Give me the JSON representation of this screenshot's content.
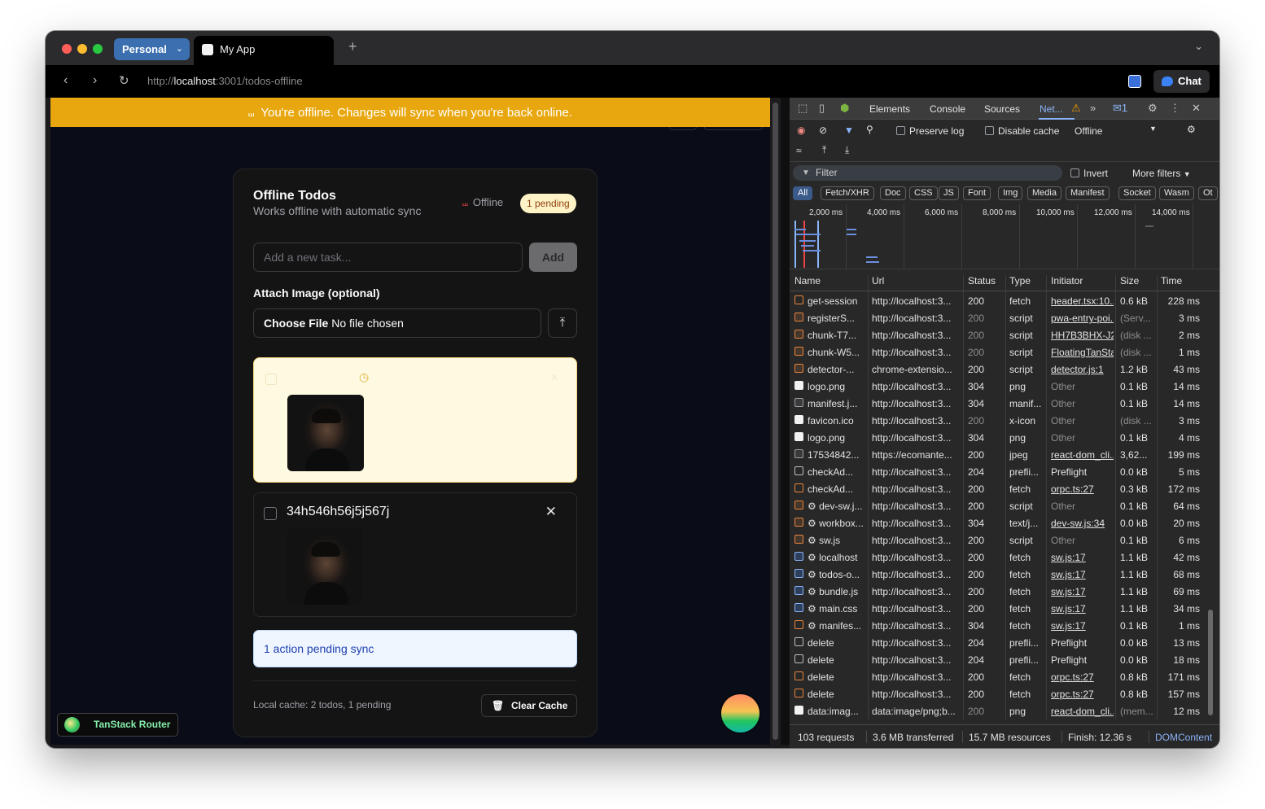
{
  "browser": {
    "profile": "Personal",
    "tab_title": "My App",
    "url_scheme": "http://",
    "url_host": "localhost",
    "url_rest": ":3001/todos-offline",
    "chat_button": "Chat"
  },
  "page": {
    "offline_banner": "You're offline. Changes will sync when you're back online.",
    "card": {
      "title": "Offline Todos",
      "subtitle": "Works offline with automatic sync",
      "status": "Offline",
      "pending_badge": "1 pending",
      "task_placeholder": "Add a new task...",
      "add_button": "Add",
      "attach_label": "Attach Image (optional)",
      "file_button": "Choose File",
      "file_status": "No file chosen",
      "todos": [
        {
          "title": "",
          "pending": true
        },
        {
          "title": "34h546h56j5j567j",
          "pending": false
        }
      ],
      "sync_notice": "1 action pending sync",
      "cache_info": "Local cache: 2 todos, 1 pending",
      "clear_cache": "Clear Cache"
    },
    "router_badge": "TanStack Router"
  },
  "devtools": {
    "tabs": [
      "Elements",
      "Console",
      "Sources",
      "Net..."
    ],
    "issues_count": "1",
    "toolbar": {
      "preserve_log": "Preserve log",
      "disable_cache": "Disable cache",
      "throttle": "Offline"
    },
    "filter_placeholder": "Filter",
    "invert": "Invert",
    "more_filters": "More filters",
    "type_filters": [
      "All",
      "Fetch/XHR",
      "Doc",
      "CSS",
      "JS",
      "Font",
      "Img",
      "Media",
      "Manifest",
      "Socket",
      "Wasm",
      "Ot"
    ],
    "timeline_labels": [
      "2,000 ms",
      "4,000 ms",
      "6,000 ms",
      "8,000 ms",
      "10,000 ms",
      "12,000 ms",
      "14,000 ms"
    ],
    "columns": [
      "Name",
      "Url",
      "Status",
      "Type",
      "Initiator",
      "Size",
      "Time"
    ],
    "requests": [
      {
        "name": "get-session",
        "url": "http://localhost:3...",
        "status": "200",
        "type": "fetch",
        "initiator": "header.tsx:10...",
        "size": "0.6 kB",
        "time": "228 ms",
        "icon": "fetch",
        "status_dim": false,
        "init_link": true,
        "size_dim": false
      },
      {
        "name": "registerS...",
        "url": "http://localhost:3...",
        "status": "200",
        "type": "script",
        "initiator": "pwa-entry-poi...",
        "size": "(Serv...",
        "time": "3 ms",
        "icon": "script",
        "status_dim": true,
        "init_link": true,
        "size_dim": true
      },
      {
        "name": "chunk-T7...",
        "url": "http://localhost:3...",
        "status": "200",
        "type": "script",
        "initiator": "HH7B3BHX-J2...",
        "size": "(disk ...",
        "time": "2 ms",
        "icon": "script",
        "status_dim": true,
        "init_link": true,
        "size_dim": true
      },
      {
        "name": "chunk-W5...",
        "url": "http://localhost:3...",
        "status": "200",
        "type": "script",
        "initiator": "FloatingTanSta...",
        "size": "(disk ...",
        "time": "1 ms",
        "icon": "script",
        "status_dim": true,
        "init_link": true,
        "size_dim": true
      },
      {
        "name": "detector-...",
        "url": "chrome-extensio...",
        "status": "200",
        "type": "script",
        "initiator": "detector.js:1",
        "size": "1.2 kB",
        "time": "43 ms",
        "icon": "script",
        "status_dim": false,
        "init_link": true,
        "size_dim": false
      },
      {
        "name": "logo.png",
        "url": "http://localhost:3...",
        "status": "304",
        "type": "png",
        "initiator": "Other",
        "size": "0.1 kB",
        "time": "14 ms",
        "icon": "img",
        "status_dim": false,
        "init_link": false,
        "size_dim": false
      },
      {
        "name": "manifest.j...",
        "url": "http://localhost:3...",
        "status": "304",
        "type": "manif...",
        "initiator": "Other",
        "size": "0.1 kB",
        "time": "14 ms",
        "icon": "doc",
        "status_dim": false,
        "init_link": false,
        "size_dim": false
      },
      {
        "name": "favicon.ico",
        "url": "http://localhost:3...",
        "status": "200",
        "type": "x-icon",
        "initiator": "Other",
        "size": "(disk ...",
        "time": "3 ms",
        "icon": "img",
        "status_dim": true,
        "init_link": false,
        "size_dim": true
      },
      {
        "name": "logo.png",
        "url": "http://localhost:3...",
        "status": "304",
        "type": "png",
        "initiator": "Other",
        "size": "0.1 kB",
        "time": "4 ms",
        "icon": "img",
        "status_dim": false,
        "init_link": false,
        "size_dim": false
      },
      {
        "name": "17534842...",
        "url": "https://ecomante...",
        "status": "200",
        "type": "jpeg",
        "initiator": "react-dom_cli...",
        "size": "3,62...",
        "time": "199 ms",
        "icon": "doc",
        "status_dim": false,
        "init_link": true,
        "size_dim": false
      },
      {
        "name": "checkAd...",
        "url": "http://localhost:3...",
        "status": "204",
        "type": "prefli...",
        "initiator": "Preflight",
        "size": "0.0 kB",
        "time": "5 ms",
        "icon": "pre",
        "status_dim": false,
        "init_link": false,
        "size_dim": false
      },
      {
        "name": "checkAd...",
        "url": "http://localhost:3...",
        "status": "200",
        "type": "fetch",
        "initiator": "orpc.ts:27",
        "size": "0.3 kB",
        "time": "172 ms",
        "icon": "fetch",
        "status_dim": false,
        "init_link": true,
        "size_dim": false
      },
      {
        "name": "⚙ dev-sw.j...",
        "url": "http://localhost:3...",
        "status": "200",
        "type": "script",
        "initiator": "Other",
        "size": "0.1 kB",
        "time": "64 ms",
        "icon": "script",
        "status_dim": false,
        "init_link": false,
        "size_dim": false
      },
      {
        "name": "⚙ workbox...",
        "url": "http://localhost:3...",
        "status": "304",
        "type": "text/j...",
        "initiator": "dev-sw.js:34",
        "size": "0.0 kB",
        "time": "20 ms",
        "icon": "script",
        "status_dim": false,
        "init_link": true,
        "size_dim": false
      },
      {
        "name": "⚙ sw.js",
        "url": "http://localhost:3...",
        "status": "200",
        "type": "script",
        "initiator": "Other",
        "size": "0.1 kB",
        "time": "6 ms",
        "icon": "script",
        "status_dim": false,
        "init_link": false,
        "size_dim": false
      },
      {
        "name": "⚙ localhost",
        "url": "http://localhost:3...",
        "status": "200",
        "type": "fetch",
        "initiator": "sw.js:17",
        "size": "1.1 kB",
        "time": "42 ms",
        "icon": "sw",
        "status_dim": false,
        "init_link": true,
        "size_dim": false
      },
      {
        "name": "⚙ todos-o...",
        "url": "http://localhost:3...",
        "status": "200",
        "type": "fetch",
        "initiator": "sw.js:17",
        "size": "1.1 kB",
        "time": "68 ms",
        "icon": "sw",
        "status_dim": false,
        "init_link": true,
        "size_dim": false
      },
      {
        "name": "⚙ bundle.js",
        "url": "http://localhost:3...",
        "status": "200",
        "type": "fetch",
        "initiator": "sw.js:17",
        "size": "1.1 kB",
        "time": "69 ms",
        "icon": "sw",
        "status_dim": false,
        "init_link": true,
        "size_dim": false
      },
      {
        "name": "⚙ main.css",
        "url": "http://localhost:3...",
        "status": "200",
        "type": "fetch",
        "initiator": "sw.js:17",
        "size": "1.1 kB",
        "time": "34 ms",
        "icon": "sw",
        "status_dim": false,
        "init_link": true,
        "size_dim": false
      },
      {
        "name": "⚙ manifes...",
        "url": "http://localhost:3...",
        "status": "304",
        "type": "fetch",
        "initiator": "sw.js:17",
        "size": "0.1 kB",
        "time": "1 ms",
        "icon": "fetch",
        "status_dim": false,
        "init_link": true,
        "size_dim": false
      },
      {
        "name": "delete",
        "url": "http://localhost:3...",
        "status": "204",
        "type": "prefli...",
        "initiator": "Preflight",
        "size": "0.0 kB",
        "time": "13 ms",
        "icon": "pre",
        "status_dim": false,
        "init_link": false,
        "size_dim": false
      },
      {
        "name": "delete",
        "url": "http://localhost:3...",
        "status": "204",
        "type": "prefli...",
        "initiator": "Preflight",
        "size": "0.0 kB",
        "time": "18 ms",
        "icon": "pre",
        "status_dim": false,
        "init_link": false,
        "size_dim": false
      },
      {
        "name": "delete",
        "url": "http://localhost:3...",
        "status": "200",
        "type": "fetch",
        "initiator": "orpc.ts:27",
        "size": "0.8 kB",
        "time": "171 ms",
        "icon": "fetch",
        "status_dim": false,
        "init_link": true,
        "size_dim": false
      },
      {
        "name": "delete",
        "url": "http://localhost:3...",
        "status": "200",
        "type": "fetch",
        "initiator": "orpc.ts:27",
        "size": "0.8 kB",
        "time": "157 ms",
        "icon": "fetch",
        "status_dim": false,
        "init_link": true,
        "size_dim": false
      },
      {
        "name": "data:imag...",
        "url": "data:image/png;b...",
        "status": "200",
        "type": "png",
        "initiator": "react-dom_cli...",
        "size": "(mem...",
        "time": "12 ms",
        "icon": "img",
        "status_dim": true,
        "init_link": true,
        "size_dim": true
      }
    ],
    "footer": {
      "requests": "103 requests",
      "transferred": "3.6 MB transferred",
      "resources": "15.7 MB resources",
      "finish": "Finish: 12.36 s",
      "domcontent": "DOMContent"
    }
  },
  "colors": {
    "banner": "#e8a70e",
    "page_bg": "#0a0d17",
    "devtools_bg": "#282828",
    "accent_blue": "#8ab4f8"
  }
}
